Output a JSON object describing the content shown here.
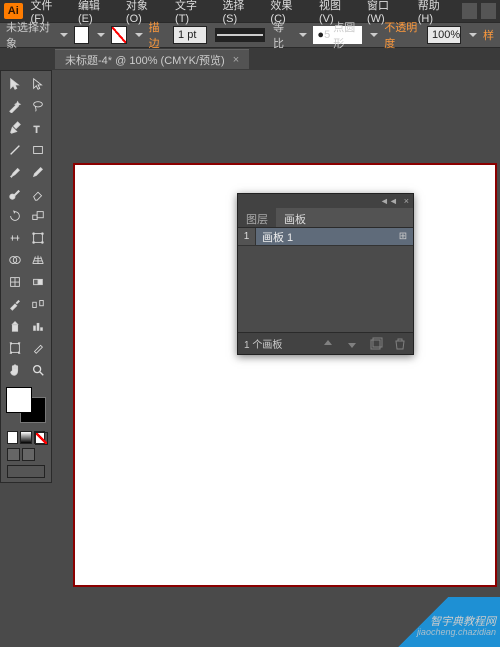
{
  "app": {
    "logo": "Ai"
  },
  "menu": {
    "file": "文件(F)",
    "edit": "编辑(E)",
    "object": "对象(O)",
    "type": "文字(T)",
    "select": "选择(S)",
    "effect": "效果(C)",
    "view": "视图(V)",
    "window": "窗口(W)",
    "help": "帮助(H)"
  },
  "options": {
    "no_selection": "未选择对象",
    "stroke_label": "描边",
    "stroke_weight": "1 pt",
    "uniform": "等比",
    "shape_value": "5",
    "shape_label": "点圆形",
    "opacity_label": "不透明度",
    "opacity_value": "100%",
    "style_label": "样"
  },
  "tab": {
    "title": "未标题-4* @ 100% (CMYK/预览)",
    "close": "×"
  },
  "panel": {
    "tabs": {
      "layers": "图层",
      "artboards": "画板"
    },
    "row_num": "1",
    "row_name": "画板 1",
    "row_indicator": "⊞",
    "footer_count": "1 个画板",
    "collapse": "◄◄",
    "close": "×"
  },
  "watermark": {
    "main": "智宇典教程网",
    "sub": "jiaocheng.chazidian"
  }
}
